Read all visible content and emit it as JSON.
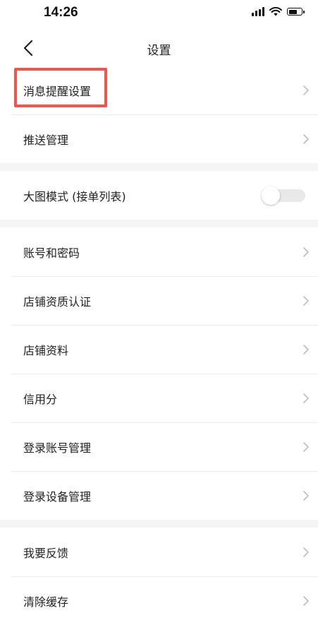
{
  "status_bar": {
    "time": "14:26"
  },
  "nav": {
    "title": "设置"
  },
  "groups": [
    {
      "items": [
        {
          "label": "消息提醒设置"
        },
        {
          "label": "推送管理"
        }
      ]
    },
    {
      "items": [
        {
          "label": "大图模式 (接单列表)",
          "toggle_on": false
        }
      ]
    },
    {
      "items": [
        {
          "label": "账号和密码"
        },
        {
          "label": "店铺资质认证"
        },
        {
          "label": "店铺资料"
        },
        {
          "label": "信用分"
        },
        {
          "label": "登录账号管理"
        },
        {
          "label": "登录设备管理"
        }
      ]
    },
    {
      "items": [
        {
          "label": "我要反馈"
        },
        {
          "label": "清除缓存"
        }
      ]
    }
  ],
  "colors": {
    "highlight": "#f2554d",
    "chevron": "#bdbdbd",
    "divider": "#ececec"
  },
  "icons": {
    "back": "chevron-left-icon",
    "disclosure": "chevron-right-icon"
  }
}
